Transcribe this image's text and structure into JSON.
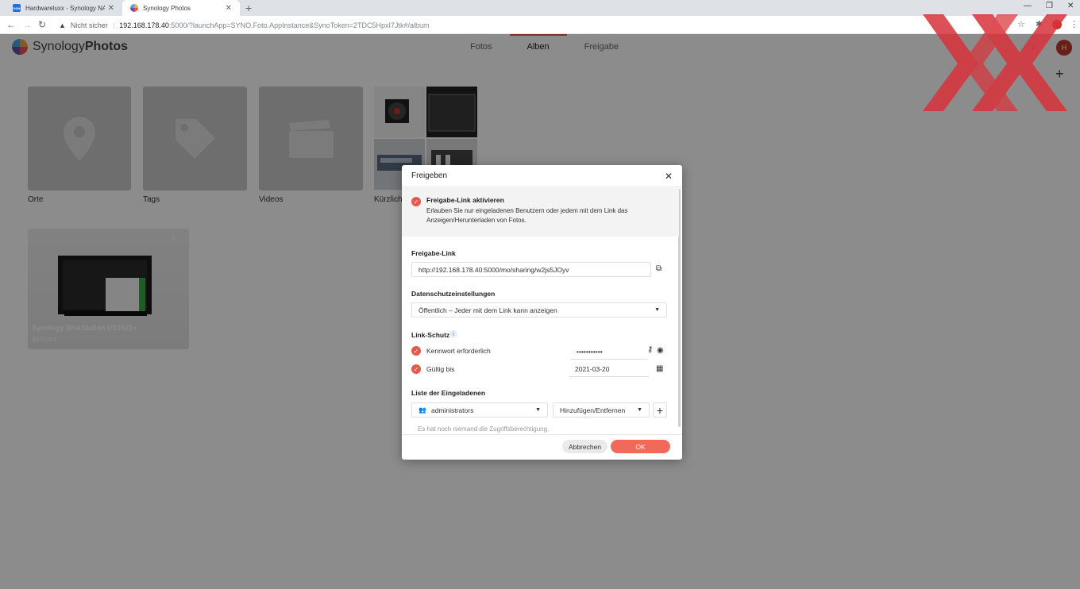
{
  "browser": {
    "tabs": [
      {
        "title": "Hardwareluxx - Synology NAS",
        "favicon": "DSM"
      },
      {
        "title": "Synology Photos"
      }
    ],
    "address": {
      "security": "Nicht sicher",
      "host": "192.168.178.40",
      "path": ":5000/?launchApp=SYNO.Foto.AppInstance&SynoToken=2TDC5HpxI7Jtk#/album"
    }
  },
  "app": {
    "logo_part1": "Synology",
    "logo_part2": "Photos",
    "nav": [
      "Fotos",
      "Alben",
      "Freigabe"
    ],
    "active_nav": "Alben",
    "avatar_initial": "H",
    "accent_color": "#e8574b"
  },
  "albums": {
    "system": [
      "Orte",
      "Tags",
      "Videos",
      "Kürzlich"
    ],
    "user": [
      {
        "title": "Synology DiskStation DS1621+",
        "count": "33 Fotos"
      }
    ]
  },
  "dialog": {
    "title": "Freigeben",
    "enable_title": "Freigabe-Link aktivieren",
    "enable_desc": "Erlauben Sie nur eingeladenen Benutzern oder jedem mit dem Link das Anzeigen/Herunterladen von Fotos.",
    "link_label": "Freigabe-Link",
    "link_value": "http://192.168.178.40:5000/mo/sharing/w2js5JOyv",
    "privacy_label": "Datenschutzeinstellungen",
    "privacy_value": "Öffentlich – Jeder mit dem Link kann anzeigen",
    "protection_label": "Link-Schutz",
    "password_label": "Kennwort erforderlich",
    "password_value": "•••••••••••",
    "valid_label": "Gültig bis",
    "valid_value": "2021-03-20",
    "invite_label": "Liste der Eingeladenen",
    "invite_user": "administrators",
    "invite_action": "Hinzufügen/Entfernen",
    "empty_note": "Es hat noch niemand die Zugriffsberechtigung.",
    "cancel": "Abbrechen",
    "ok": "OK"
  }
}
